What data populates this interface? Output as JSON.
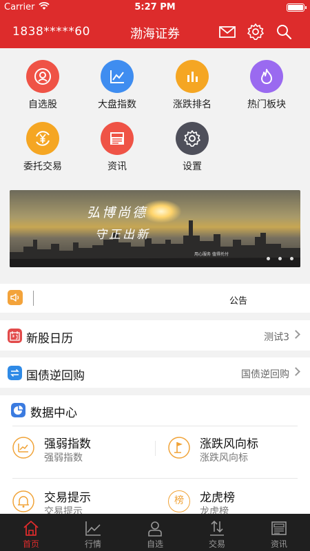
{
  "status_bar": {
    "carrier": "Carrier",
    "time": "5:27 PM"
  },
  "header": {
    "account": "1838*****60",
    "title": "渤海证券",
    "icons": [
      "mail-icon",
      "gear-icon",
      "search-icon"
    ]
  },
  "shortcuts": [
    {
      "label": "自选股",
      "icon": "user-star-icon",
      "color": "#ef5346"
    },
    {
      "label": "大盘指数",
      "icon": "line-chart-icon",
      "color": "#3f8df0"
    },
    {
      "label": "涨跌排名",
      "icon": "bar-chart-icon",
      "color": "#f5a623"
    },
    {
      "label": "热门板块",
      "icon": "flame-icon",
      "color": "#9a6af0"
    },
    {
      "label": "委托交易",
      "icon": "yen-exchange-icon",
      "color": "#f5a623"
    },
    {
      "label": "资讯",
      "icon": "news-icon",
      "color": "#ef5346"
    },
    {
      "label": "设置",
      "icon": "gear-icon",
      "color": "#4e4f5a"
    }
  ],
  "banner": {
    "slogan_line1": "弘博尚德",
    "slogan_line2": "守正出新",
    "small_text": "用心服务 值得托付",
    "page_count": 3
  },
  "notice": {
    "text": "公告"
  },
  "rows": [
    {
      "title": "新股日历",
      "right": "测试3",
      "icon": "calendar-icon",
      "color": "#e24a4a"
    },
    {
      "title": "国债逆回购",
      "right": "国债逆回购",
      "icon": "exchange-icon",
      "color": "#2f8ae6"
    }
  ],
  "data_center": {
    "title": "数据中心",
    "items": [
      {
        "name": "强弱指数",
        "sub": "强弱指数",
        "icon": "chart-up-icon",
        "glyph": ""
      },
      {
        "name": "涨跌风向标",
        "sub": "涨跌风向标",
        "icon": "flag-icon",
        "glyph": ""
      },
      {
        "name": "交易提示",
        "sub": "交易提示",
        "icon": "bell-icon",
        "glyph": ""
      },
      {
        "name": "龙虎榜",
        "sub": "龙虎榜",
        "icon": "rank-icon",
        "glyph": "榜"
      }
    ]
  },
  "tabs": [
    {
      "label": "首页",
      "active": true
    },
    {
      "label": "行情",
      "active": false
    },
    {
      "label": "自选",
      "active": false
    },
    {
      "label": "交易",
      "active": false
    },
    {
      "label": "资讯",
      "active": false
    }
  ]
}
